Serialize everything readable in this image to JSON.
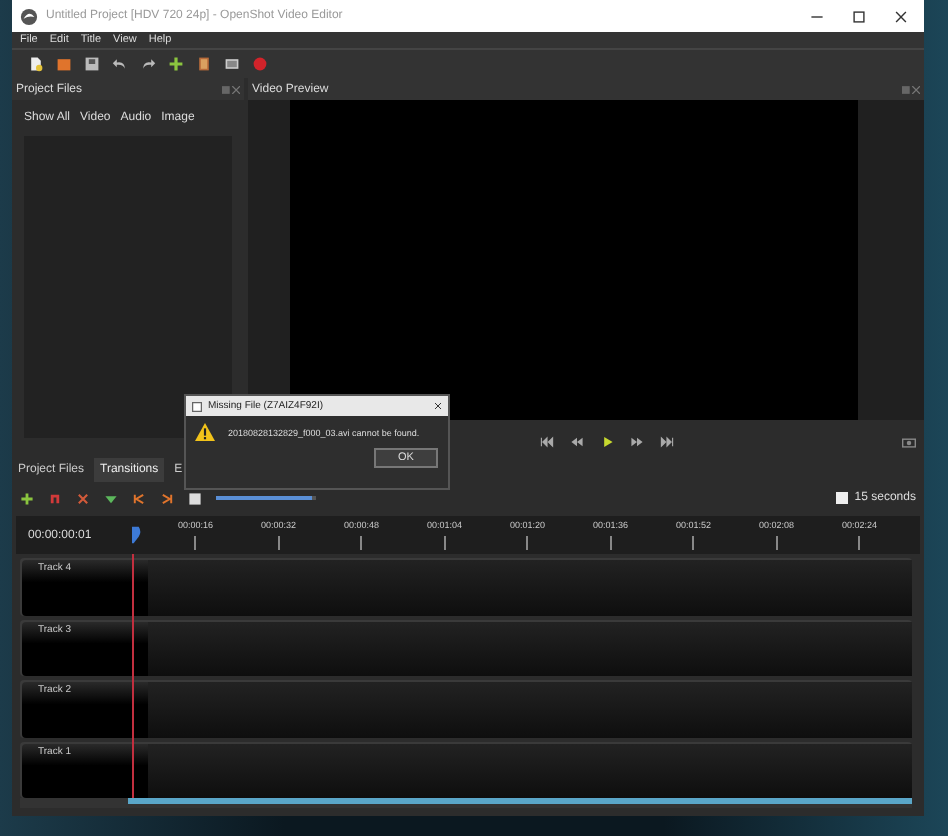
{
  "window": {
    "title": "Untitled Project [HDV 720 24p] - OpenShot Video Editor"
  },
  "menu": [
    "File",
    "Edit",
    "Title",
    "View",
    "Help"
  ],
  "project_files": {
    "title": "Project Files",
    "filters": [
      "Show All",
      "Video",
      "Audio",
      "Image"
    ]
  },
  "video_preview": {
    "title": "Video Preview"
  },
  "bottom_tabs": [
    {
      "label": "Project Files",
      "selected": false
    },
    {
      "label": "Transitions",
      "selected": true
    },
    {
      "label": "E",
      "selected": false
    }
  ],
  "dialog": {
    "title": "Missing File (Z7AIZ4F92I)",
    "message": "20180828132829_f000_03.avi cannot be found.",
    "button": "OK"
  },
  "timeline": {
    "zoom": {
      "level": 0.95,
      "label": "15 seconds",
      "checked": false
    },
    "current_time": "00:00:00:01",
    "ticks": [
      "00:00:16",
      "00:00:32",
      "00:00:48",
      "00:01:04",
      "00:01:20",
      "00:01:36",
      "00:01:52",
      "00:02:08",
      "00:02:24"
    ],
    "tracks": [
      {
        "name": "Track 4"
      },
      {
        "name": "Track 3"
      },
      {
        "name": "Track 2"
      },
      {
        "name": "Track 1"
      }
    ]
  }
}
